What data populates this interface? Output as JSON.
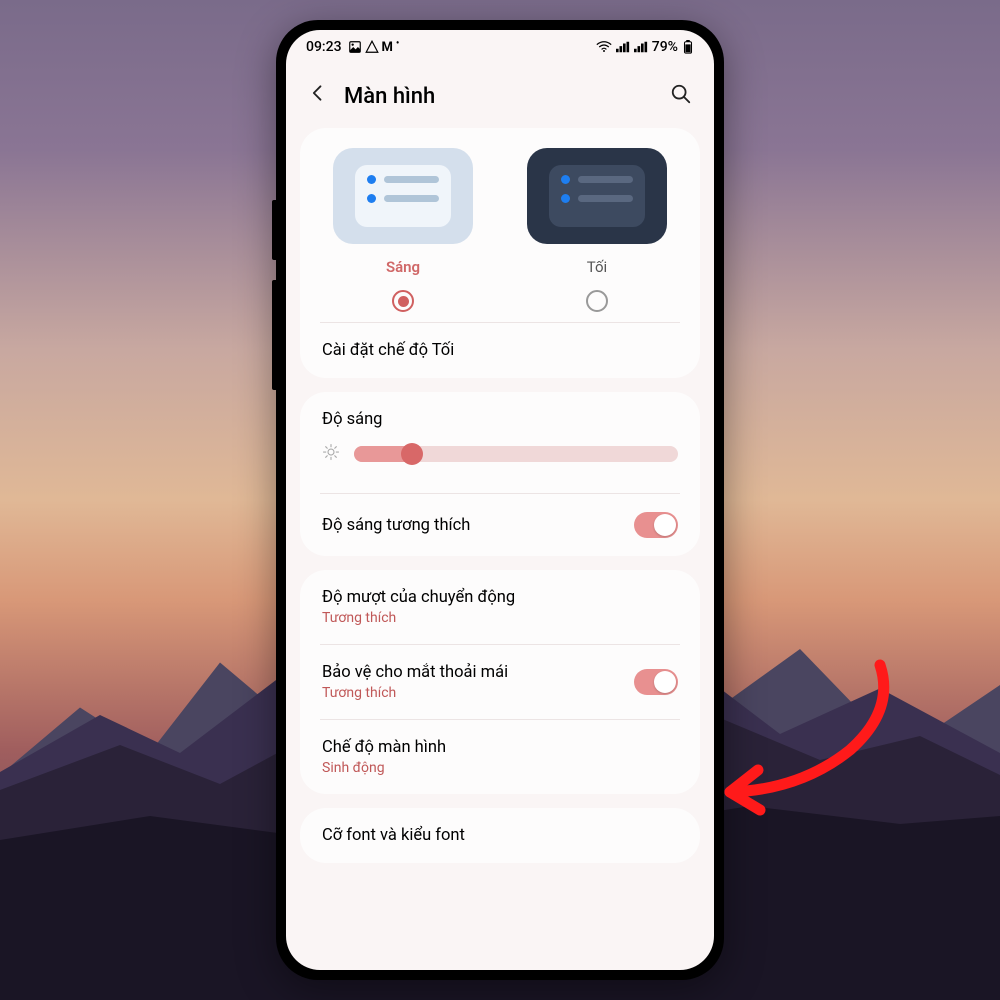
{
  "status_bar": {
    "time": "09:23",
    "left_icons": "🖼 ✈ M •",
    "right_icons": "📶 📶 📶",
    "battery": "79%"
  },
  "header": {
    "title": "Màn hình"
  },
  "theme": {
    "light_label": "Sáng",
    "dark_label": "Tối",
    "selected": "light"
  },
  "dark_mode_settings": "Cài đặt chế độ Tối",
  "brightness": {
    "label": "Độ sáng",
    "value_percent": 18
  },
  "adaptive_brightness": {
    "label": "Độ sáng tương thích",
    "enabled": true
  },
  "motion_smoothness": {
    "label": "Độ mượt của chuyển động",
    "value": "Tương thích"
  },
  "eye_comfort": {
    "label": "Bảo vệ cho mắt thoải mái",
    "value": "Tương thích",
    "enabled": true
  },
  "screen_mode": {
    "label": "Chế độ màn hình",
    "value": "Sinh động"
  },
  "font": {
    "label": "Cỡ font và kiểu font"
  },
  "colors": {
    "accent": "#d86868",
    "accent_light": "#e89898"
  }
}
